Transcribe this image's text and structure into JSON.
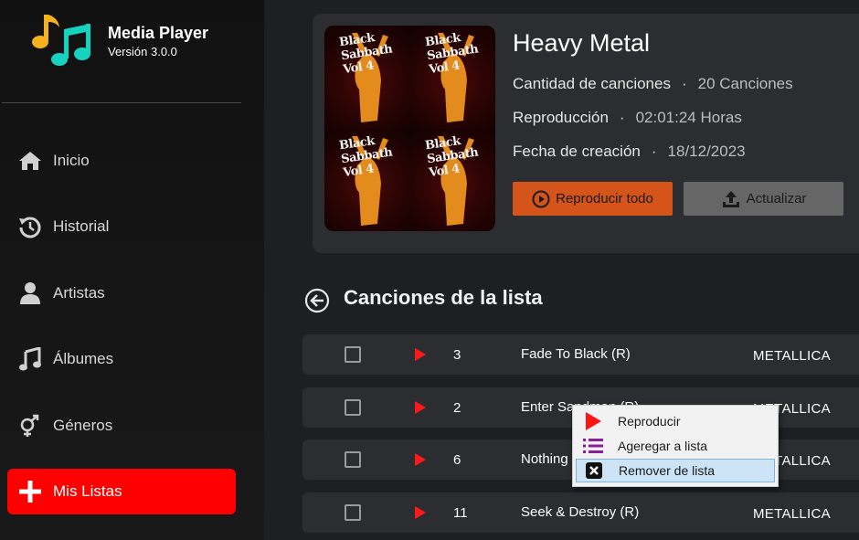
{
  "app": {
    "title": "Media Player",
    "version": "Versión 3.0.0"
  },
  "nav": {
    "items": [
      {
        "label": "Inicio",
        "icon": "home-icon"
      },
      {
        "label": "Historial",
        "icon": "history-icon"
      },
      {
        "label": "Artistas",
        "icon": "user-icon"
      },
      {
        "label": "Álbumes",
        "icon": "music-note-icon"
      },
      {
        "label": "Géneros",
        "icon": "gender-icon"
      },
      {
        "label": "Mis Listas",
        "icon": "plus-icon",
        "active": true
      }
    ]
  },
  "playlist": {
    "title": "Heavy Metal",
    "cover_text": "Black Sabbath Vol 4",
    "song_count_label": "Cantidad de canciones",
    "song_count_value": "20 Canciones",
    "duration_label": "Reproducción",
    "duration_value": "02:01:24 Horas",
    "created_label": "Fecha de creación",
    "created_value": "18/12/2023",
    "separator": "·",
    "play_all_label": "Reproducir todo",
    "update_label": "Actualizar"
  },
  "songs_section": {
    "title": "Canciones de la lista",
    "rows": [
      {
        "number": "3",
        "title": "Fade To Black (R)",
        "artist": "METALLICA"
      },
      {
        "number": "2",
        "title": "Enter Sandman (R)",
        "artist": "METALLICA"
      },
      {
        "number": "6",
        "title": "Nothing Else Matters (R)",
        "artist": "METALLICA"
      },
      {
        "number": "11",
        "title": "Seek & Destroy (R)",
        "artist": "METALLICA"
      }
    ]
  },
  "context_menu": {
    "items": [
      {
        "label": "Reproducir",
        "icon": "play-icon"
      },
      {
        "label": "Ageregar a lista",
        "icon": "list-icon"
      },
      {
        "label": "Remover de lista",
        "icon": "remove-icon"
      }
    ]
  },
  "colors": {
    "accent_red": "#ff0000",
    "play_button": "#d4541a",
    "update_button": "#666666",
    "card_bg": "#2c2d30"
  }
}
